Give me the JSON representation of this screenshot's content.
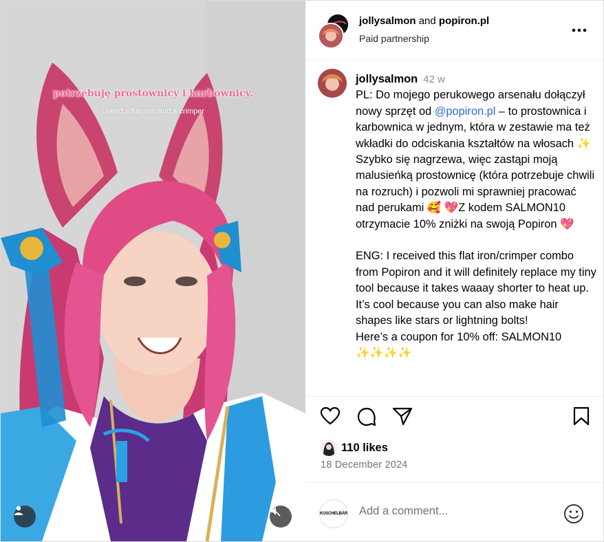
{
  "media": {
    "overlay_caption_pl": "potrzebuję prostownicy i karbownicy.",
    "overlay_caption_en": "I need a flat iron and a crimper",
    "user_icon": "person-icon",
    "mute_icon": "speaker-muted-icon"
  },
  "header": {
    "user1": "jollysalmon",
    "and_text": " and ",
    "user2": "popiron.pl",
    "subtitle": "Paid partnership",
    "more_icon": "more-horizontal-icon"
  },
  "caption": {
    "username": "jollysalmon",
    "time": "42 w",
    "pl_part1": "PL: Do mojego perukowego arsenału dołączył nowy sprzęt od ",
    "mention": "@popiron.pl",
    "pl_part2": " – to prostownica i karbownica w jednym, która w zestawie ma też wkładki do odciskania kształtów na włosach ✨ Szybko się nagrzewa, więc zastąpi moją malusieńką prostownicę (która potrzebuje chwili na rozruch) i pozwoli mi sprawniej pracować nad perukami 🥰 💖Z kodem SALMON10 otrzymacie 10% zniżki na swoją Popiron 💖",
    "eng": "ENG: I received this flat iron/crimper combo from Popiron and it will definitely replace my tiny tool because it takes waaay shorter to heat up. It’s cool because you can also make hair shapes like stars or lightning bolts!\nHere’s a coupon for 10% off: SALMON10",
    "trailing": "✨✨✨✨"
  },
  "actions": {
    "like_icon": "heart-icon",
    "comment_icon": "comment-icon",
    "share_icon": "paper-plane-icon",
    "save_icon": "bookmark-icon"
  },
  "likes": "110 likes",
  "date": "18 December 2024",
  "comment": {
    "placeholder": "Add a comment...",
    "avatar_text": "KUSCHELBÄR",
    "emoji_icon": "smiley-icon"
  },
  "colors": {
    "link": "#2f6bdc",
    "muted": "#737373",
    "hair": "#d9447c",
    "ribbon": "#1f8fd1"
  }
}
